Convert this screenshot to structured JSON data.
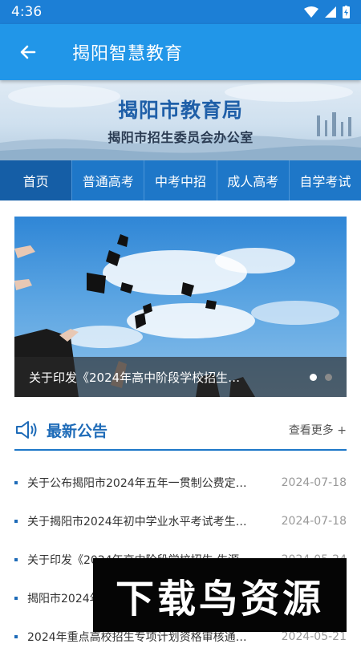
{
  "status_bar": {
    "time": "4:36"
  },
  "app_bar": {
    "title": "揭阳智慧教育"
  },
  "banner": {
    "title": "揭阳市教育局",
    "subtitle": "揭阳市招生委员会办公室"
  },
  "nav": {
    "items": [
      {
        "label": "首页",
        "active": true
      },
      {
        "label": "普通高考"
      },
      {
        "label": "中考中招"
      },
      {
        "label": "成人高考"
      },
      {
        "label": "自学考试"
      }
    ]
  },
  "carousel": {
    "caption": "关于印发《2024年高中阶段学校招生…",
    "slide_count": 2,
    "active_index": 0
  },
  "announcements": {
    "title": "最新公告",
    "more_label": "查看更多 +",
    "items": [
      {
        "title": "关于公布揭阳市2024年五年一贯制公费定…",
        "date": "2024-07-18"
      },
      {
        "title": "关于揭阳市2024年初中学业水平考试考生…",
        "date": "2024-07-18"
      },
      {
        "title": "关于印发《2024年高中阶段学校招生 生源…",
        "date": "2024-05-24"
      },
      {
        "title": "揭阳市2024年…",
        "date": ""
      },
      {
        "title": "2024年重点高校招生专项计划资格审核通…",
        "date": "2024-05-21"
      }
    ]
  },
  "watermark": {
    "text": "下载鸟资源"
  },
  "colors": {
    "primary": "#2196e8",
    "nav": "#1e77c8",
    "nav_active": "#155ea6",
    "accent_text": "#1e6bb8"
  }
}
